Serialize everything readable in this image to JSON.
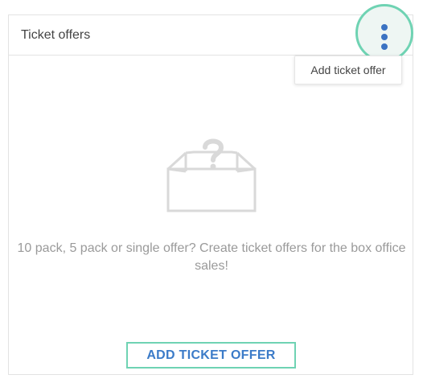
{
  "panel": {
    "title": "Ticket offers",
    "menu_icon": "more-vertical-icon"
  },
  "menu": {
    "items": [
      {
        "label": "Add ticket offer"
      }
    ]
  },
  "empty_state": {
    "icon": "empty-box-question-icon",
    "message": "10 pack, 5 pack or single offer? Create ticket offers for the box office sales!"
  },
  "actions": {
    "add_label": "ADD TICKET OFFER"
  },
  "colors": {
    "accent_teal": "#6fd3b3",
    "primary_blue": "#3b7bc8",
    "muted_text": "#9a9a9a",
    "border": "#e3e3e3"
  }
}
